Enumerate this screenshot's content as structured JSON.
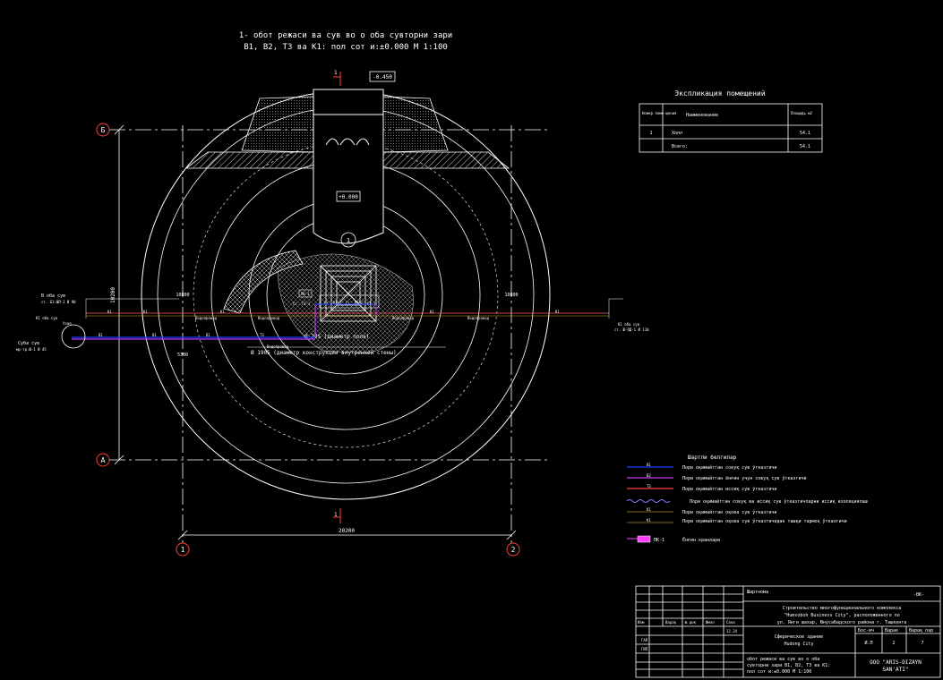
{
  "header": {
    "title_line1": "1- обот режаси ва сув во о оба сувторни зари",
    "title_line2": "В1, В2, Т3 ва К1: пол сот и:±0.000 М 1:100"
  },
  "axes": {
    "B": "Б",
    "A": "А",
    "one": "1",
    "two": "2",
    "dim_vertical": "10200",
    "dim_horizontal": "20200",
    "dim_left_short": "5300",
    "dim_mid_left": "10800",
    "dim_mid_right": "10800",
    "section_mark": "1"
  },
  "plan": {
    "top_level": "-0.450",
    "floor_level": "+0.000",
    "room_no": "1",
    "label_diameter_floor": "Ø 705 (диаметр пола)",
    "label_diameter_wall": "Ø 1905 (диаметр конструкции внутренней стены)",
    "label_water_mains": "Водопровод",
    "label_stoyak1": "Ст. В1-1",
    "label_stoyak2": "Ст. В2-1",
    "label_stoyak3": "Ст. Т3-1",
    "label_stoyak4": "Ст. К1-1",
    "label_pk": "ПК-1",
    "left_pipe_top_title": "В оба сув",
    "left_pipe_top_sub": "ст. Б1:ШЛ-1 Ø 90",
    "left_pipe_mid_title": "К1 оба сув",
    "left_pipe_bot_title": "Суба сув",
    "left_pipe_bot_sub": "мр-тр.Ш-1 Ø 45",
    "left_node_label": "Узел",
    "right_pipe_title": "К1 оба сув",
    "right_pipe_sub": "ст. Ш-ОД-1 Ø 110",
    "pipe_tag_v1": "В1",
    "pipe_tag_k1": "К1",
    "pipe_tag_t3": "Т3"
  },
  "explication": {
    "title": "Экспликация помещений",
    "col_number": "Номер поме-щения",
    "col_name": "Наименование",
    "col_area": "Площадь м2",
    "rows": [
      {
        "no": "1",
        "name": "Холл",
        "area": "54.1"
      },
      {
        "no": "",
        "name": "Всего:",
        "area": "54.1"
      }
    ]
  },
  "legend": {
    "title": "Шартли белгилар",
    "items": [
      {
        "tag": "В1",
        "text": "Пори оқимайтган совуқ сув ўтказгичи",
        "color": "#1a3cff"
      },
      {
        "tag": "В2",
        "text": "Пори оқимайтган ёнғин учун совуқ сув ўтказгичи",
        "color": "#c03cff"
      },
      {
        "tag": "Т3",
        "text": "Пори оқимайтган иссиқ сув ўтказгичи",
        "color": "#ff3c3c"
      },
      {
        "tag": "",
        "text": "Пори оқимайтган совуқ ва иссиқ сув ўтказгичларни иссиқ изоляциялаш",
        "color": "#8a7cff"
      },
      {
        "tag": "К1",
        "text": "Пори оқимайтган оқова сув ўтказгичи",
        "color": "#ffd23c"
      },
      {
        "tag": "К1",
        "text": "Пори оқимайтган оқова сув ўтказгичидан ташқи тармоқ ўтказгичи",
        "color": "#ffd23c"
      },
      {
        "tag": "ПК-1",
        "text": "Ёнғин кранлари",
        "color": "#ff3cff"
      }
    ]
  },
  "title_block": {
    "code": "-ВК-",
    "project_line1": "Строительство многофункционального комплекса",
    "project_line2": "\"Humsoboh Business City\", расположенного по",
    "project_line3": "ул. Янги шахар, Юнусабадского района г. Ташкента",
    "notes_label": "Шартнома",
    "object_line1": "Сферическое здание",
    "object_line2": "Hudong City",
    "sheet_title_line1": "обот режаси ва сув во о оба",
    "sheet_title_line2": "сувторни зари В1, В2, Т3 ва К1:",
    "sheet_title_line3": "пол сот и:±0.000 М 1:100",
    "stage_label": "Бос-ич",
    "sheet_label": "Варак",
    "sheets_label": "Варақ лар",
    "stage": "И.П",
    "sheet": "2",
    "sheets": "7",
    "company_line1": "ООО \"ARIS-DIZAYN",
    "company_line2": "SAN'ATI\"",
    "col_izm": "Изм",
    "col_sheet": "Варақ",
    "col_doc": "№ док",
    "col_sign": "Имзо",
    "col_date": "Сана",
    "row_gap": "ГАП",
    "row_gip": "ГИП",
    "date": "12.24"
  }
}
